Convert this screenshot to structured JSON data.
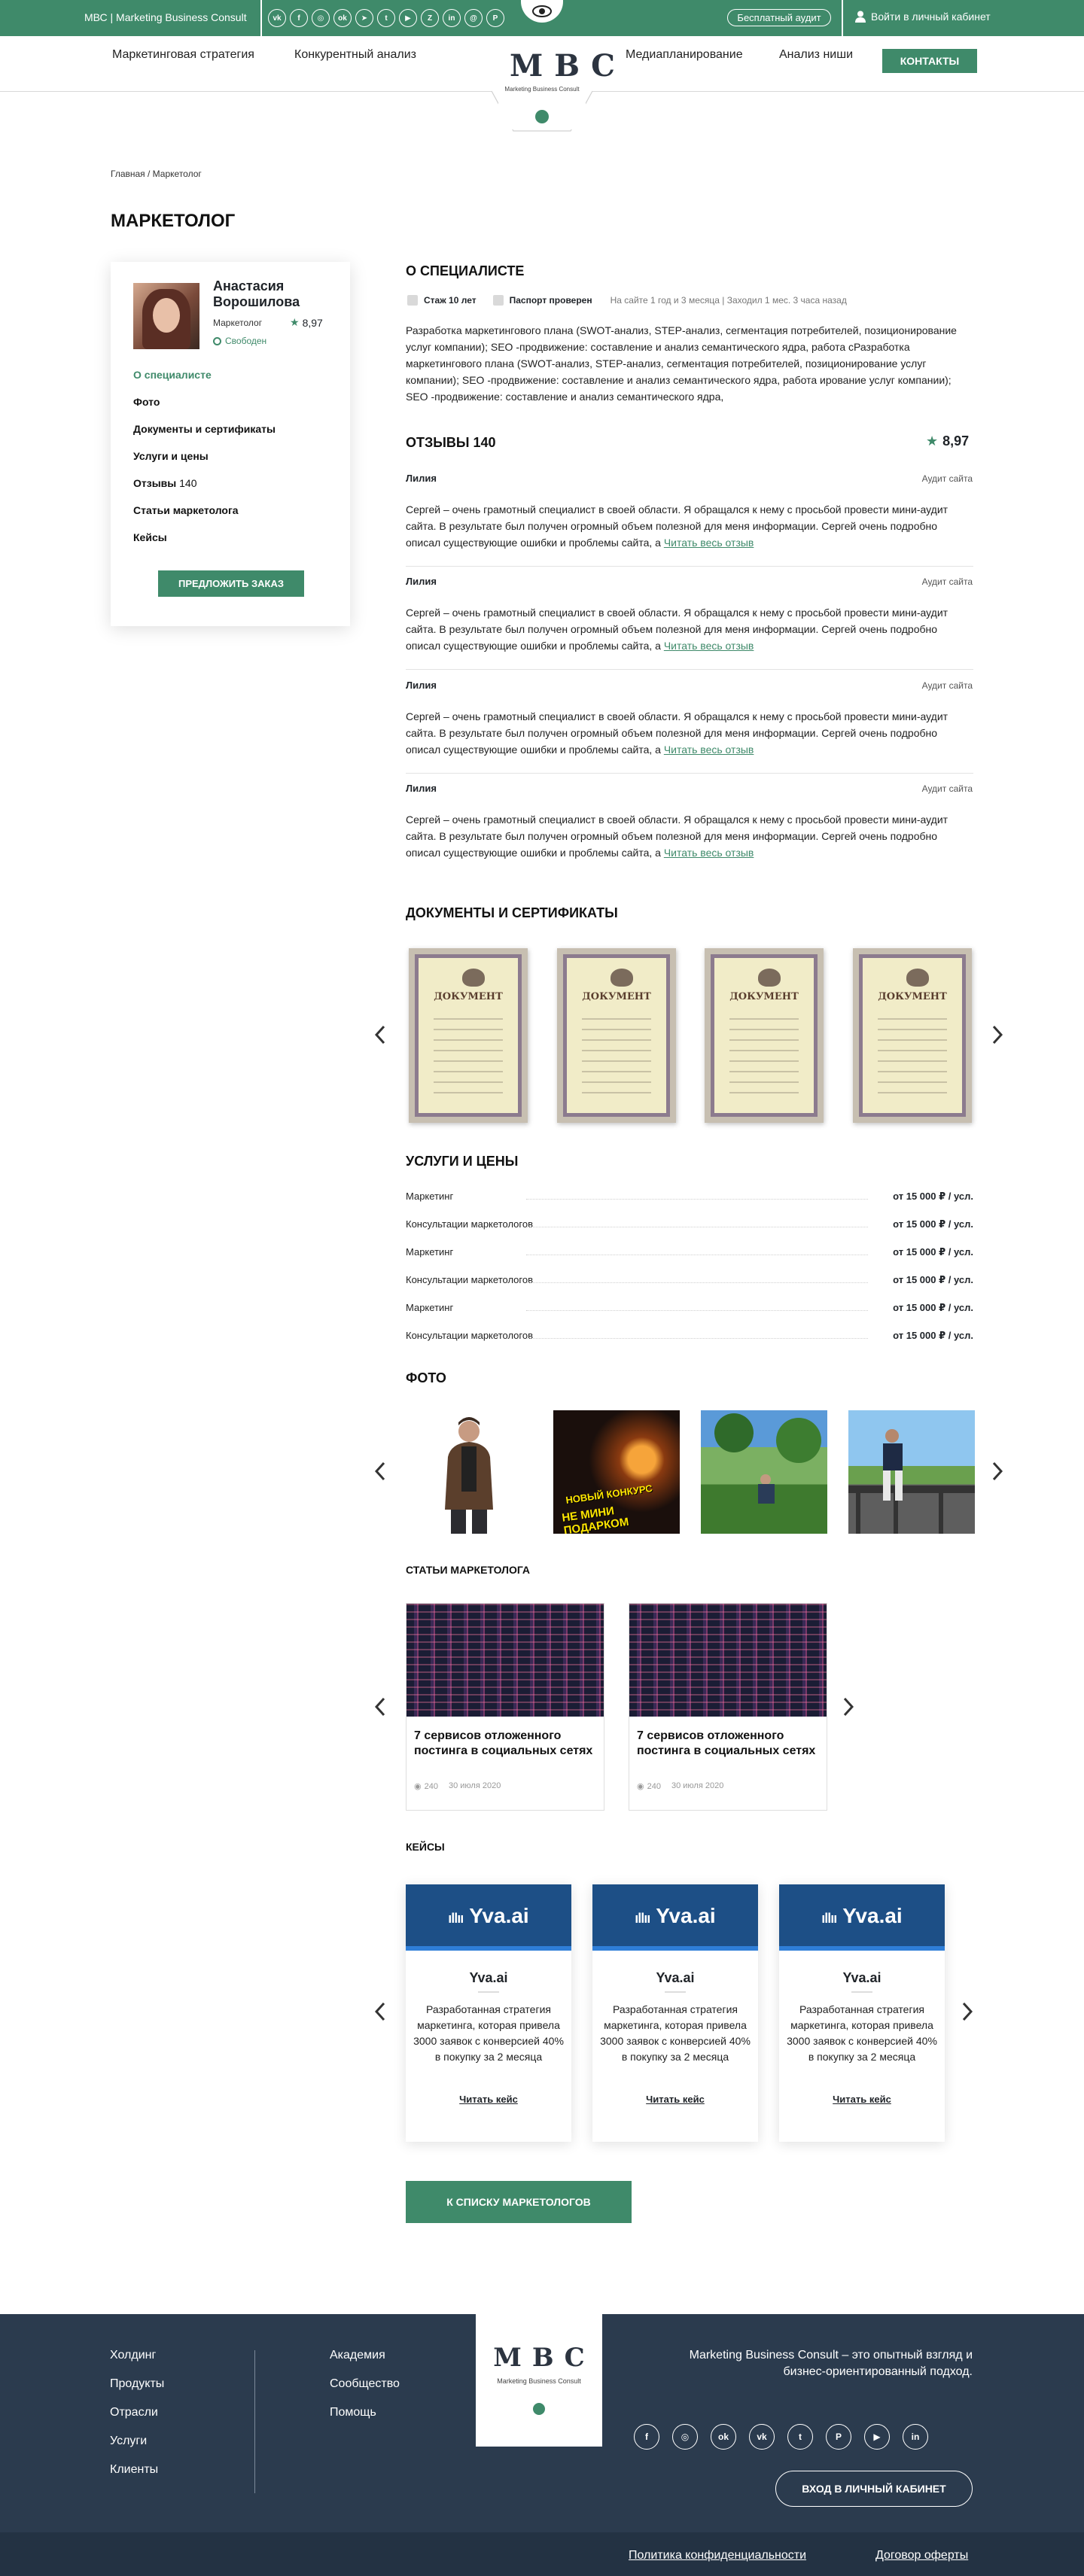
{
  "topbar": {
    "site_name": "МВС | Marketing Business Consult",
    "social_icons": [
      "vk-icon",
      "facebook-icon",
      "instagram-icon",
      "odnoklassniki-icon",
      "telegram-icon",
      "twitter-icon",
      "youtube-icon",
      "yandex-zen-icon",
      "linkedin-icon",
      "mail-ru-icon",
      "pinterest-icon"
    ],
    "social_glyphs": [
      "vk",
      "f",
      "◎",
      "ok",
      "➤",
      "t",
      "▶",
      "Z",
      "in",
      "@",
      "P"
    ],
    "free_audit": "Бесплатный аудит",
    "cabinet": "Войти в личный кабинет"
  },
  "nav": {
    "strategy": "Маркетинговая стратегия",
    "competitors": "Конкурентный анализ",
    "media": "Медиапланирование",
    "niche": "Анализ ниши",
    "contacts": "КОНТАКТЫ"
  },
  "logo": {
    "letters": "МВС",
    "sub": "Marketing Business Consult"
  },
  "breadcrumb": "Главная / Маркетолог",
  "page_title": "МАРКЕТОЛОГ",
  "profile": {
    "name": "Анастасия Ворошилова",
    "role": "Маркетолог",
    "rating": "8,97",
    "status": "Свободен",
    "menu": {
      "about": "О специалисте",
      "photo": "Фото",
      "docs": "Документы и сертификаты",
      "services": "Услуги и цены",
      "reviews": "Отзывы",
      "reviews_count": "140",
      "articles": "Статьи маркетолога",
      "cases": "Кейсы"
    },
    "offer_button": "ПРЕДЛОЖИТЬ ЗАКАЗ"
  },
  "about": {
    "title": "О СПЕЦИАЛИСТЕ",
    "experience": "Стаж 10 лет",
    "passport": "Паспорт проверен",
    "site_info": "На сайте 1 год и 3 месяца | Заходил 1 мес. 3 часа назад",
    "text": "Разработка маркетингового плана (SWOT-анализ, STEP-анализ, сегментация потребителей, позиционирование услуг компании); SEO -продвижение: составление и анализ семантического ядра, работа сРазработка маркетингового плана (SWOT-анализ, STEP-анализ, сегментация потребителей, позиционирование услуг компании); SEO -продвижение: составление и анализ семантического ядра, работа ирование услуг компании); SEO -продвижение: составление и анализ семантического ядра,"
  },
  "reviews": {
    "title": "ОТЗЫВЫ 140",
    "rating": "8,97",
    "items": [
      {
        "name": "Лилия",
        "tag": "Аудит сайта",
        "text": "Сергей – очень грамотный специалист в  своей области. Я обращался к нему с просьбой провести мини-аудит сайта. В результате был получен  огромный объем  полезной для меня информации. Сергей  очень подробно описал существующие ошибки и проблемы  сайта, а ",
        "more": "Читать весь отзыв"
      },
      {
        "name": "Лилия",
        "tag": "Аудит сайта",
        "text": "Сергей – очень грамотный специалист в  своей области. Я обращался к нему с просьбой провести мини-аудит сайта. В результате был получен  огромный объем  полезной для меня информации. Сергей  очень подробно описал существующие ошибки и проблемы  сайта, а ",
        "more": "Читать весь отзыв"
      },
      {
        "name": "Лилия",
        "tag": "Аудит сайта",
        "text": "Сергей – очень грамотный специалист в  своей области. Я обращался к нему с просьбой провести мини-аудит сайта. В результате был получен  огромный объем  полезной для меня информации. Сергей  очень подробно описал существующие ошибки и проблемы  сайта, а ",
        "more": "Читать весь отзыв"
      },
      {
        "name": "Лилия",
        "tag": "Аудит сайта",
        "text": "Сергей – очень грамотный специалист в  своей области. Я обращался к нему с просьбой провести мини-аудит сайта. В результате был получен  огромный объем  полезной для меня информации. Сергей  очень подробно описал существующие ошибки и проблемы  сайта, а ",
        "more": "Читать весь отзыв"
      }
    ]
  },
  "documents": {
    "title": "ДОКУМЕНТЫ И СЕРТИФИКАТЫ",
    "doc_label": "ДОКУМЕНТ"
  },
  "services": {
    "title": "УСЛУГИ И ЦЕНЫ",
    "items": [
      {
        "name": "Маркетинг",
        "price": "от 15 000 ₽ / усл."
      },
      {
        "name": "Консультации маркетологов",
        "price": "от 15 000 ₽ / усл."
      },
      {
        "name": "Маркетинг",
        "price": "от 15 000 ₽ / усл."
      },
      {
        "name": "Консультации маркетологов",
        "price": "от 15 000 ₽ / усл."
      },
      {
        "name": "Маркетинг",
        "price": "от 15 000 ₽ / усл."
      },
      {
        "name": "Консультации маркетологов",
        "price": "от 15 000 ₽ / усл."
      }
    ]
  },
  "photos": {
    "title": "ФОТО",
    "promo_text": "НЕ МИНИ ПОДАРКОМ",
    "promo_text2": "НОВЫЙ КОНКУРС"
  },
  "articles": {
    "title": "СТАТЬИ МАРКЕТОЛОГА",
    "items": [
      {
        "title": "7 сервисов отложенного постинга в социальных сетях",
        "views": "240",
        "date": "30 июля 2020"
      },
      {
        "title": "7 сервисов отложенного постинга в социальных сетях",
        "views": "240",
        "date": "30 июля 2020"
      }
    ]
  },
  "cases": {
    "title": "КЕЙСЫ",
    "items": [
      {
        "logo": "Yva.ai",
        "name": "Yva.ai",
        "text": "Разработанная стратегия маркетинга, которая привела 3000 заявок с конверсией 40% в покупку за 2 месяца",
        "link": "Читать кейс"
      },
      {
        "logo": "Yva.ai",
        "name": "Yva.ai",
        "text": "Разработанная стратегия маркетинга, которая привела 3000 заявок с конверсией 40% в покупку за 2 месяца",
        "link": "Читать кейс"
      },
      {
        "logo": "Yva.ai",
        "name": "Yva.ai",
        "text": "Разработанная стратегия маркетинга, которая привела 3000 заявок с конверсией 40% в покупку за 2 месяца",
        "link": "Читать кейс"
      }
    ]
  },
  "back_button": "К СПИСКУ МАРКЕТОЛОГОВ",
  "footer": {
    "col1": [
      "Холдинг",
      "Продукты",
      "Отрасли",
      "Услуги",
      "Клиенты"
    ],
    "col2": [
      "Академия",
      "Сообщество",
      "Помощь"
    ],
    "tagline": "Marketing Business Consult – это опытный взгляд и бизнес-ориентированный подход.",
    "social_icons": [
      "facebook-icon",
      "instagram-icon",
      "odnoklassniki-icon",
      "vk-icon",
      "twitter-icon",
      "pinterest-icon",
      "youtube-icon",
      "linkedin-icon"
    ],
    "social_glyphs": [
      "f",
      "◎",
      "ok",
      "vk",
      "t",
      "P",
      "▶",
      "in"
    ],
    "cabinet_button": "ВХОД В ЛИЧНЫЙ КАБИНЕТ",
    "privacy": "Политика конфиденциальности",
    "offer": "Договор оферты"
  },
  "colors": {
    "brand_green": "#3f8a6a",
    "footer_bg": "#2b3b4e",
    "case_blue": "#1d4f86"
  }
}
